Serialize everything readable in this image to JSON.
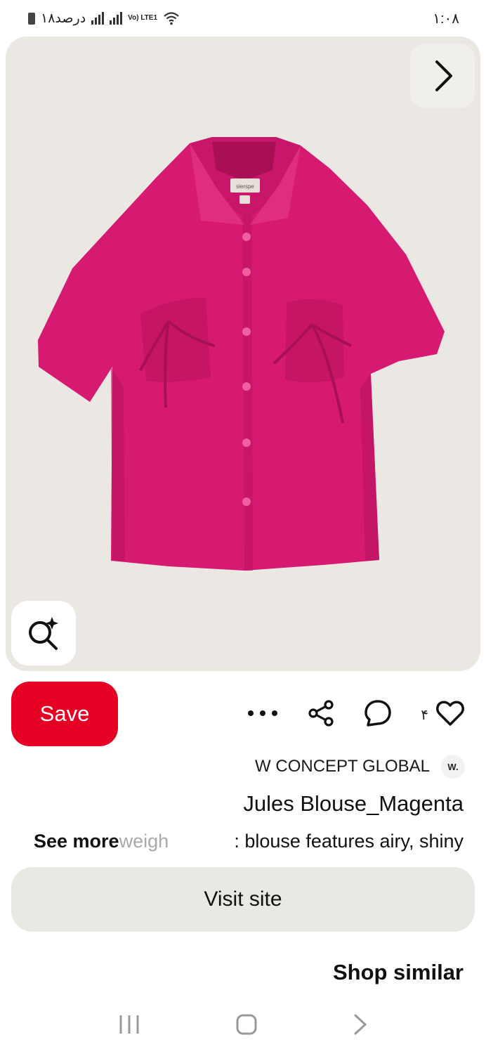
{
  "status_bar": {
    "battery_text": "۱۸درصد",
    "network_label": "Vo) LTE1",
    "time": "۱:۰۸"
  },
  "pin": {
    "likes_count": "۴",
    "source_name": "W CONCEPT GLOBAL",
    "source_logo_text": "W.",
    "title": "Jules Blouse_Magenta",
    "description_fragment_faded": "weigh",
    "description_visible": ": blouse features airy, shiny",
    "see_more_label": "See more",
    "save_label": "Save",
    "visit_label": "Visit site",
    "shop_similar_label": "Shop similar",
    "label_text": "sierspe"
  },
  "colors": {
    "save_red": "#e60023",
    "shirt_magenta": "#d61a72",
    "image_bg": "#ebe8e3"
  },
  "icons": {
    "next": "chevron-right-icon",
    "lens": "visual-search-icon",
    "more": "more-icon",
    "share": "share-icon",
    "comment": "comment-icon",
    "like": "heart-icon"
  }
}
